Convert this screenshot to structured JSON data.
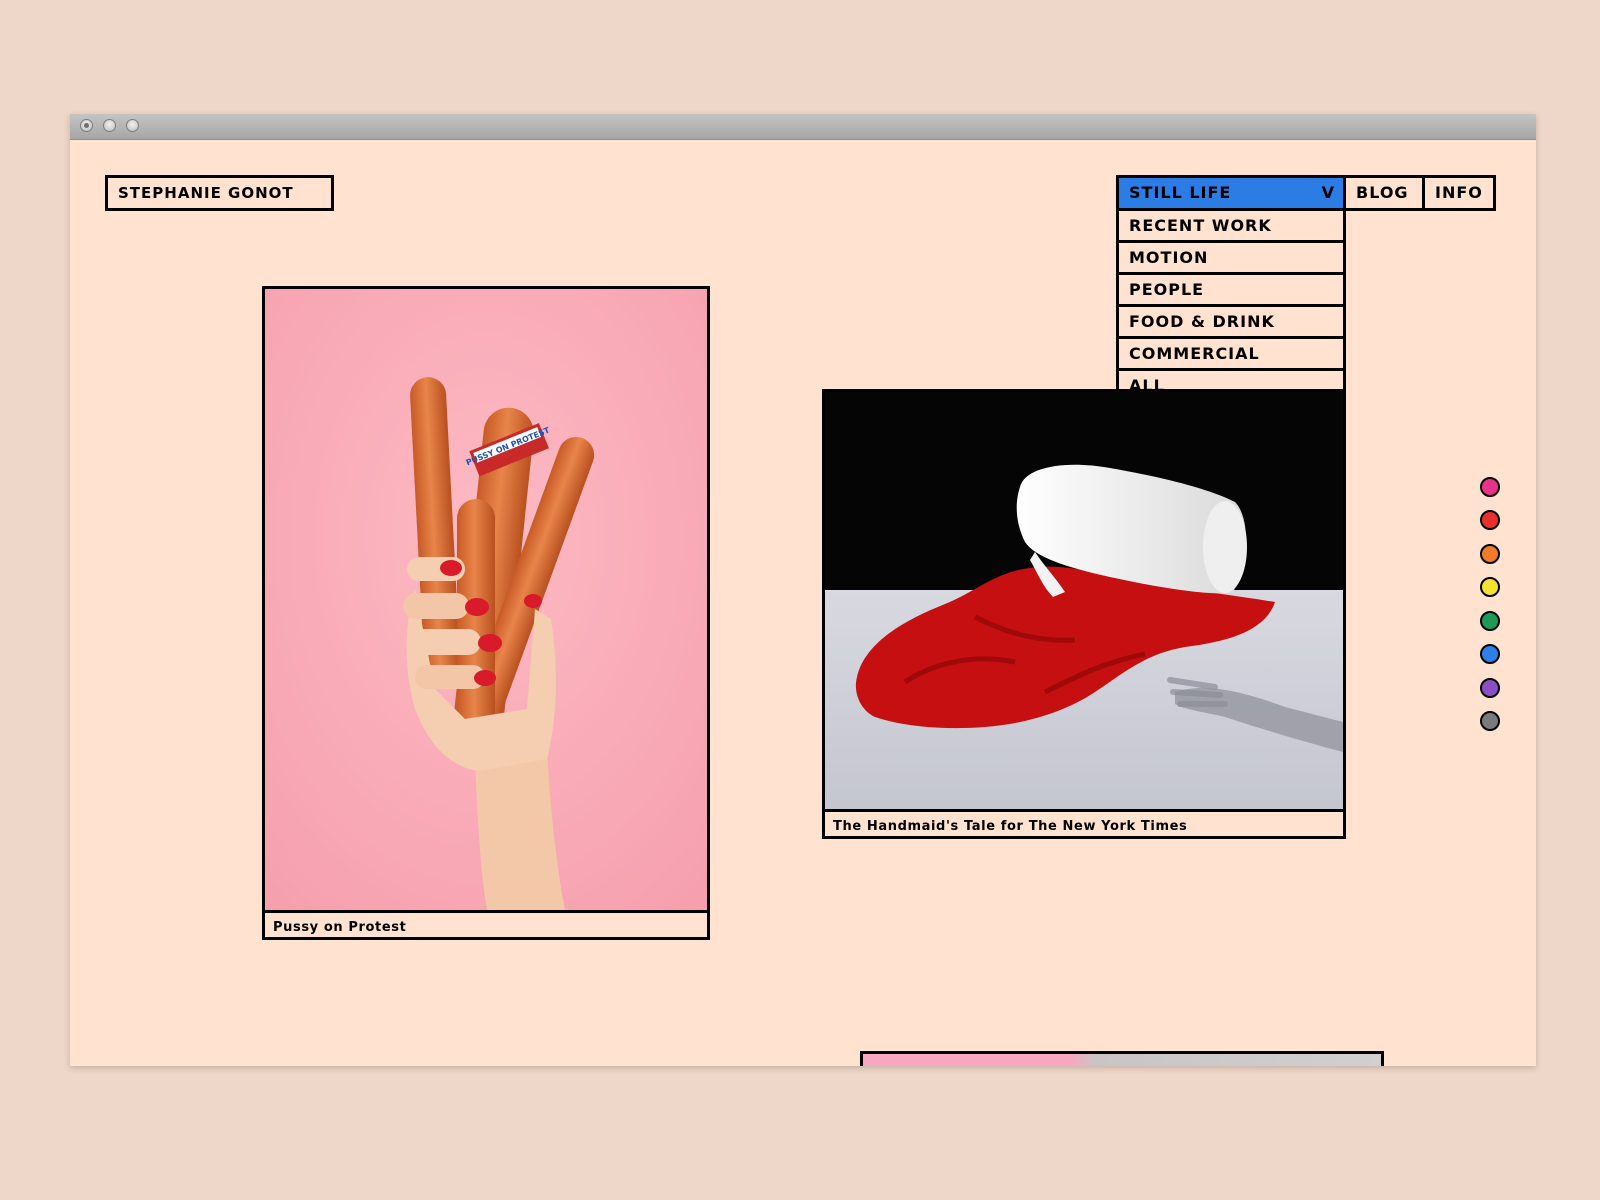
{
  "site": {
    "logo": "STEPHANIE GONOT"
  },
  "nav": {
    "active": "STILL LIFE",
    "active_chevron": "V",
    "blog": "BLOG",
    "info": "INFO",
    "dropdown": [
      "RECENT WORK",
      "MOTION",
      "PEOPLE",
      "FOOD & DRINK",
      "COMMERCIAL",
      "ALL"
    ]
  },
  "projects": [
    {
      "caption": "Pussy on Protest",
      "pin_text": "PUSSY ON PROTEST"
    },
    {
      "caption": "The Handmaid's Tale for The New York Times"
    }
  ],
  "colors": {
    "page_bg": "#ffe2cf",
    "accent": "#2c7ce6",
    "filter_dots": [
      "#e8338a",
      "#e8312e",
      "#f07c2a",
      "#f2e332",
      "#1f9a55",
      "#2f7fe8",
      "#8a4fc4",
      "#7a7a7a"
    ]
  }
}
